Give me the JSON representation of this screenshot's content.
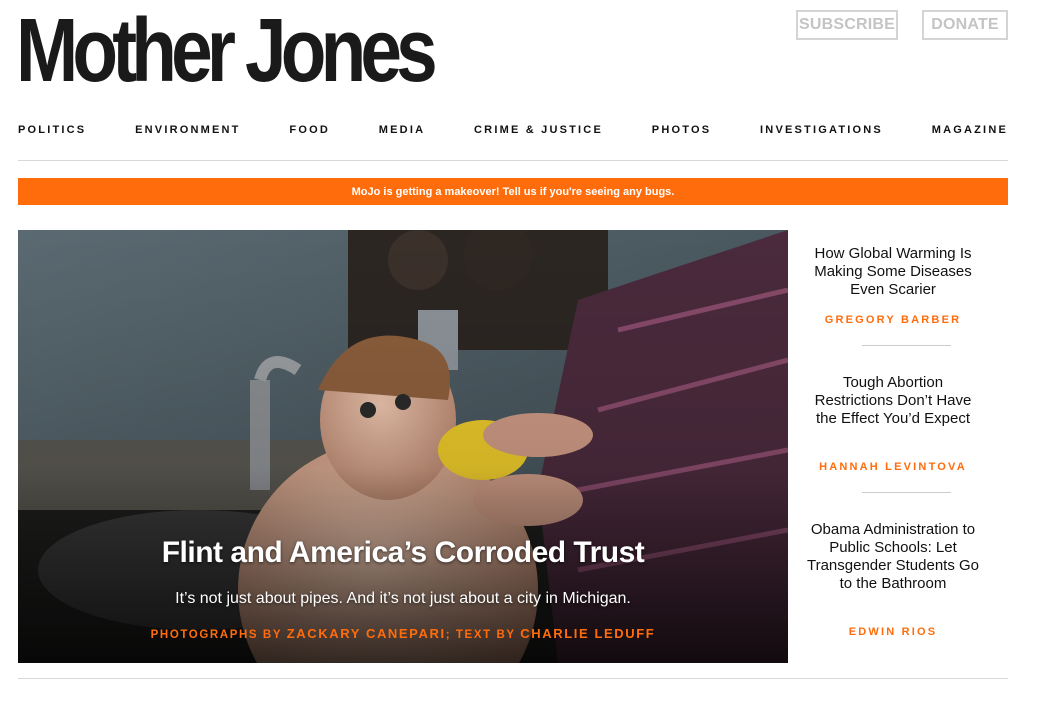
{
  "header": {
    "logo": "Mother Jones",
    "subscribe_label": "SUBSCRIBE",
    "donate_label": "DONATE"
  },
  "nav": {
    "items": [
      "POLITICS",
      "ENVIRONMENT",
      "FOOD",
      "MEDIA",
      "CRIME & JUSTICE",
      "PHOTOS",
      "INVESTIGATIONS",
      "MAGAZINE"
    ]
  },
  "banner": {
    "text": "MoJo is getting a makeover! Tell us if you're seeing any bugs."
  },
  "hero": {
    "title": "Flint and America’s Corroded Trust",
    "dek": "It’s not just about pipes. And it’s not just about a city in Michigan.",
    "byline_prefix1": "PHOTOGRAPHS BY",
    "byline_name1": "ZACKARY CANEPARI",
    "byline_sep": ";",
    "byline_prefix2": "TEXT BY",
    "byline_name2": "CHARLIE LEDUFF"
  },
  "sidebar": {
    "articles": [
      {
        "title": "How Global Warming Is Making Some Diseases Even Scarier",
        "author": "GREGORY BARBER"
      },
      {
        "title": "Tough Abortion Restrictions Don’t Have the Effect You’d Expect",
        "author": "HANNAH LEVINTOVA"
      },
      {
        "title": "Obama Administration to Public Schools: Let Transgender Students Go to the Bathroom",
        "author": "EDWIN RIOS"
      }
    ]
  },
  "colors": {
    "accent": "#ff6c0c"
  }
}
